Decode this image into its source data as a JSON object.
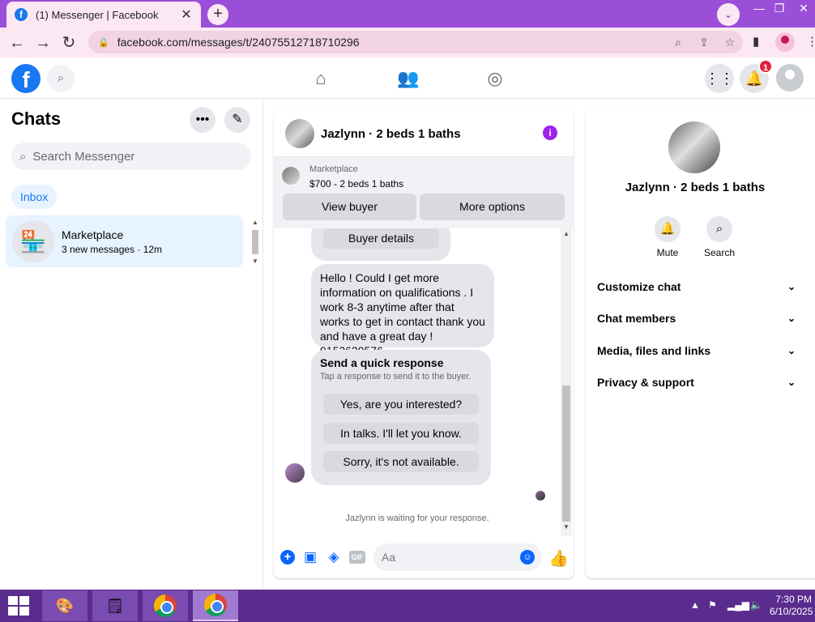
{
  "browser": {
    "tab_title": "(1) Messenger | Facebook",
    "tab_close": "✕",
    "new_tab": "+",
    "url": "facebook.com/messages/t/24075512718710296"
  },
  "header": {
    "logo": "f",
    "notification_count": "1"
  },
  "chats": {
    "title": "Chats",
    "search_placeholder": "Search Messenger",
    "inbox_label": "Inbox",
    "items": [
      {
        "name": "Marketplace",
        "subtitle": "3 new messages · 12m"
      }
    ]
  },
  "conversation": {
    "name": "Jazlynn · 2 beds 1 baths",
    "marketplace_label": "Marketplace",
    "listing": "$700 - 2 beds 1 baths",
    "view_buyer": "View buyer",
    "more_options": "More options",
    "buyer_details": "Buyer details",
    "message": "Hello ! Could I get more information on qualifications . I work 8-3 anytime after that works to get in contact thank you and have a great day ! 9152629576",
    "quick_title": "Send a quick response",
    "quick_sub": "Tap a response to send it to the buyer.",
    "quick_responses": [
      "Yes, are you interested?",
      "In talks. I'll let you know.",
      "Sorry, it's not available."
    ],
    "waiting": "Jazlynn is waiting for your response.",
    "input_placeholder": "Aa",
    "gif_label": "GIF"
  },
  "info": {
    "name": "Jazlynn · 2 beds 1 baths",
    "mute": "Mute",
    "search": "Search",
    "rows": [
      "Customize chat",
      "Chat members",
      "Media, files and links",
      "Privacy & support"
    ]
  },
  "taskbar": {
    "time": "7:30 PM",
    "date": "6/10/2025"
  },
  "colors": {
    "tabbar": "#9b4fd8",
    "accent": "#1877f2",
    "taskbar": "#5a2c8e"
  }
}
